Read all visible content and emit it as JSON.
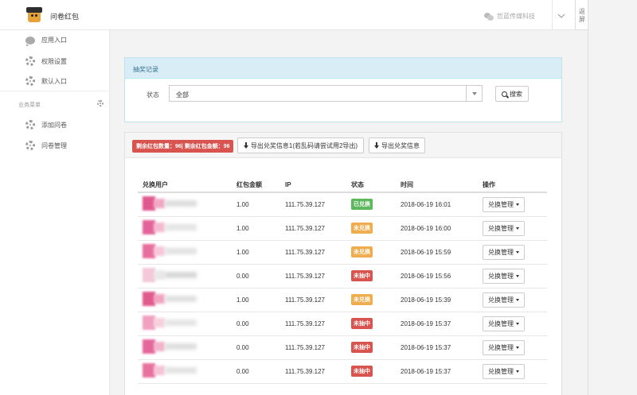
{
  "header": {
    "app_title": "问卷红包",
    "org_name": "哲蓝传媒科技"
  },
  "edge": {
    "text": "返屏"
  },
  "sidebar": {
    "items": [
      {
        "label": "应用入口",
        "icon": "chat-bubble-icon"
      },
      {
        "label": "权限设置",
        "icon": "gear-icon"
      },
      {
        "label": "默认入口",
        "icon": "gear-icon"
      }
    ],
    "section_label": "业务菜单",
    "section_items": [
      {
        "label": "添加问卷",
        "icon": "gear-icon"
      },
      {
        "label": "问卷管理",
        "icon": "gear-icon"
      }
    ]
  },
  "filter_panel": {
    "heading": "抽奖记录",
    "status_label": "状态",
    "status_value": "全部",
    "search_label": "搜索"
  },
  "records_panel": {
    "stats_badge": "剩余红包数量：96| 剩余红包金额：96",
    "export_all_label": "导出兑奖信息1(若乱码请尝试用2导出)",
    "export_2_label": "导出兑奖信息",
    "columns": [
      "兑换用户",
      "红包金额",
      "IP",
      "状态",
      "时间",
      "操作"
    ],
    "rows": [
      {
        "amount": "1.00",
        "ip": "111.75.39.127",
        "status": "已兑换",
        "status_color": "#5cb85c",
        "time": "2018-06-19 16:01",
        "action": "兑换管理"
      },
      {
        "amount": "1.00",
        "ip": "111.75.39.127",
        "status": "未兑换",
        "status_color": "#f0ad4e",
        "time": "2018-06-19 16:00",
        "action": "兑换管理"
      },
      {
        "amount": "1.00",
        "ip": "111.75.39.127",
        "status": "未兑换",
        "status_color": "#f0ad4e",
        "time": "2018-06-19 15:59",
        "action": "兑换管理"
      },
      {
        "amount": "0.00",
        "ip": "111.75.39.127",
        "status": "未抽中",
        "status_color": "#d9534f",
        "time": "2018-06-19 15:56",
        "action": "兑换管理"
      },
      {
        "amount": "1.00",
        "ip": "111.75.39.127",
        "status": "未兑换",
        "status_color": "#f0ad4e",
        "time": "2018-06-19 15:39",
        "action": "兑换管理"
      },
      {
        "amount": "0.00",
        "ip": "111.75.39.127",
        "status": "未抽中",
        "status_color": "#d9534f",
        "time": "2018-06-19 15:37",
        "action": "兑换管理"
      },
      {
        "amount": "0.00",
        "ip": "111.75.39.127",
        "status": "未抽中",
        "status_color": "#d9534f",
        "time": "2018-06-19 15:37",
        "action": "兑换管理"
      },
      {
        "amount": "0.00",
        "ip": "111.75.39.127",
        "status": "未抽中",
        "status_color": "#d9534f",
        "time": "2018-06-19 15:37",
        "action": "兑换管理"
      }
    ]
  }
}
